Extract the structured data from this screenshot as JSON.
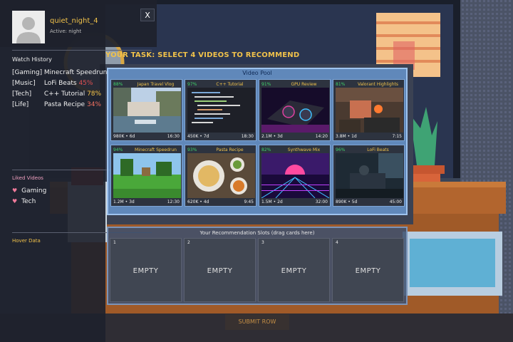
{
  "profile": {
    "username": "quiet_night_4",
    "status": "Active: night",
    "close_label": "X"
  },
  "watch_history": {
    "title": "Watch History",
    "items": [
      {
        "category": "[Gaming]",
        "title": "Minecraft Speedrun",
        "pct": "",
        "color": "#f0f0f0"
      },
      {
        "category": "[Music]",
        "title": "LoFi Beats",
        "pct": "45%",
        "color": "#e05050"
      },
      {
        "category": "[Tech]",
        "title": "C++ Tutorial",
        "pct": "78%",
        "color": "#f1c24a"
      },
      {
        "category": "[Life]",
        "title": "Pasta Recipe",
        "pct": "34%",
        "color": "#f07060"
      }
    ]
  },
  "liked_videos": {
    "title": "Liked Videos",
    "items": [
      "Gaming",
      "Tech"
    ]
  },
  "hover_data": {
    "title": "Hover Data"
  },
  "task": "YOUR TASK: SELECT 4 VIDEOS TO RECOMMEND",
  "video_pool": {
    "title": "Video Pool",
    "cards": [
      {
        "pct": "88%",
        "title": "Japan Travel Vlog",
        "stats": "980K • 6d",
        "duration": "16:30",
        "thumb": "travel"
      },
      {
        "pct": "97%",
        "title": "C++ Tutorial",
        "stats": "450K • 7d",
        "duration": "18:30",
        "thumb": "code"
      },
      {
        "pct": "91%",
        "title": "GPU Review",
        "stats": "2.1M • 3d",
        "duration": "14:20",
        "thumb": "gpu"
      },
      {
        "pct": "81%",
        "title": "Valorant Highlights",
        "stats": "3.8M • 1d",
        "duration": "7:15",
        "thumb": "fps"
      },
      {
        "pct": "94%",
        "title": "Minecraft Speedrun",
        "stats": "1.2M • 3d",
        "duration": "12:30",
        "thumb": "minecraft"
      },
      {
        "pct": "93%",
        "title": "Pasta Recipe",
        "stats": "620K • 4d",
        "duration": "9:45",
        "thumb": "food"
      },
      {
        "pct": "82%",
        "title": "Synthwave Mix",
        "stats": "1.5M • 2d",
        "duration": "32:00",
        "thumb": "synth"
      },
      {
        "pct": "96%",
        "title": "LoFi Beats",
        "stats": "890K • 5d",
        "duration": "45:00",
        "thumb": "lofi"
      }
    ]
  },
  "slots": {
    "title": "Your Recommendation Slots (drag cards here)",
    "items": [
      {
        "num": "1",
        "label": "EMPTY"
      },
      {
        "num": "2",
        "label": "EMPTY"
      },
      {
        "num": "3",
        "label": "EMPTY"
      },
      {
        "num": "4",
        "label": "EMPTY"
      }
    ]
  },
  "submit_label": "SUBMIT ROW",
  "colors": {
    "accent": "#f1c24a",
    "match_green": "#3fd26a",
    "pool_blue": "#6ea0dc"
  }
}
